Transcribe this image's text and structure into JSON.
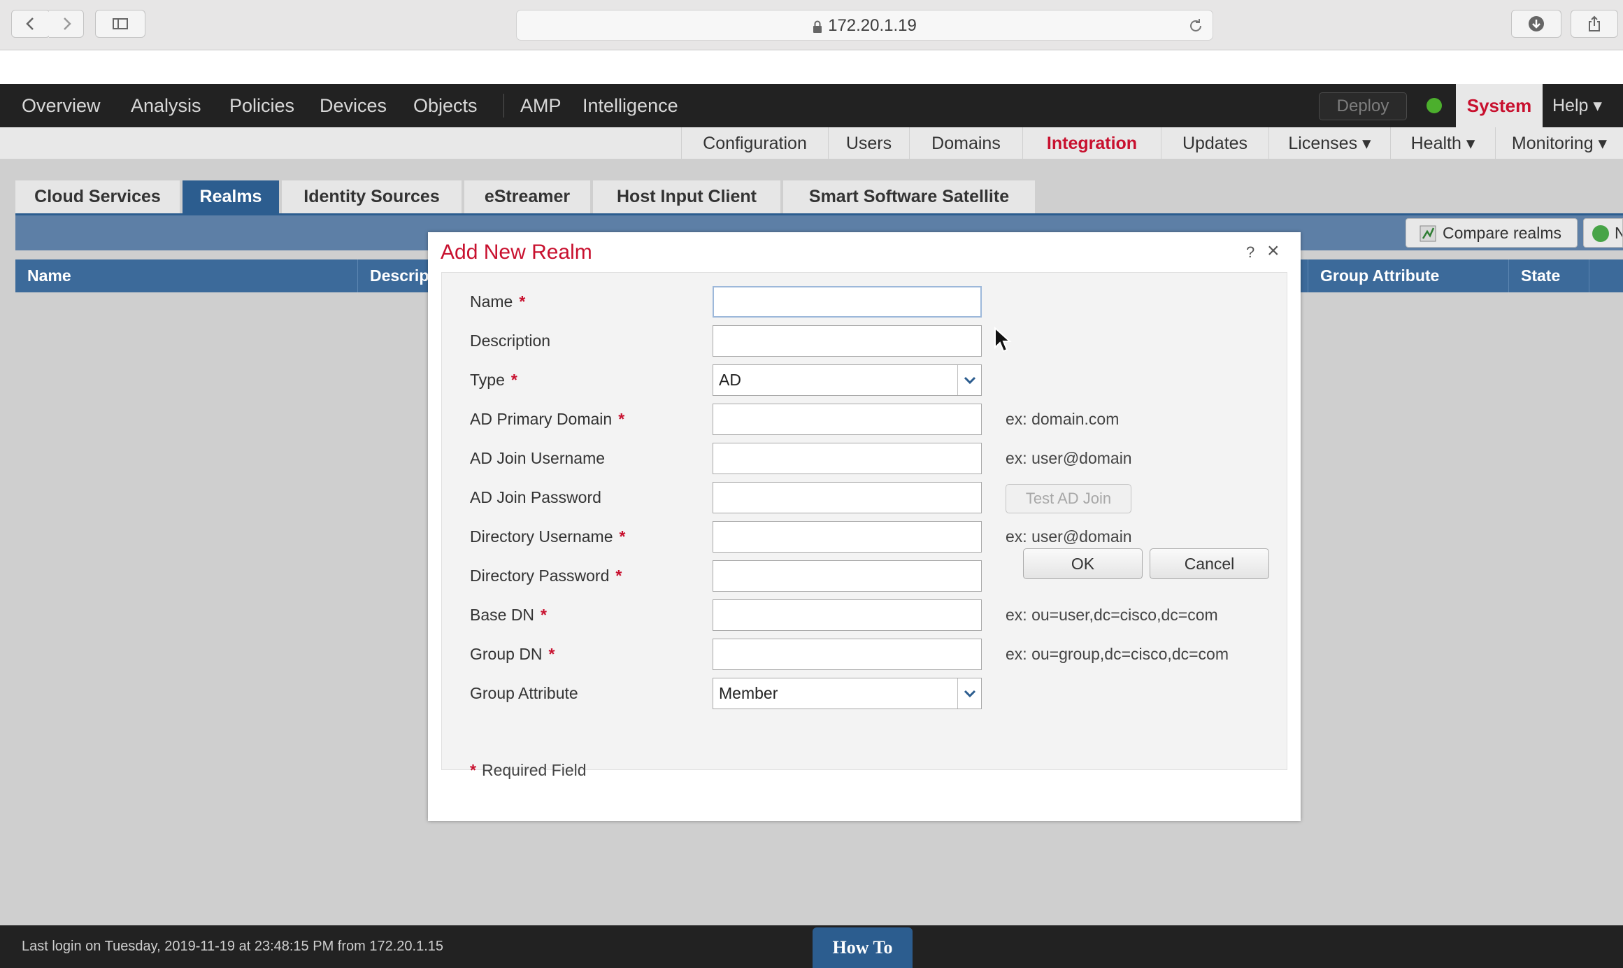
{
  "browser": {
    "url": "172.20.1.19"
  },
  "nav": {
    "items": [
      "Overview",
      "Analysis",
      "Policies",
      "Devices",
      "Objects",
      "AMP",
      "Intelligence"
    ],
    "deploy": "Deploy",
    "system": "System",
    "help": "Help ▾"
  },
  "subnav": {
    "items": [
      "Configuration",
      "Users",
      "Domains",
      "Integration",
      "Updates",
      "Licenses ▾",
      "Health ▾",
      "Monitoring ▾"
    ],
    "active": "Integration"
  },
  "tabs": {
    "items": [
      "Cloud Services",
      "Realms",
      "Identity Sources",
      "eStreamer",
      "Host Input Client",
      "Smart Software Satellite"
    ],
    "active": "Realms"
  },
  "toolbar": {
    "compare": "Compare realms",
    "add": "N"
  },
  "table": {
    "columns": [
      "Name",
      "Descrip",
      "Group Attribute",
      "State"
    ]
  },
  "modal": {
    "title": "Add New Realm",
    "help": "?",
    "close": "×",
    "fields": [
      {
        "label": "Name",
        "required": true,
        "value": "",
        "hint": ""
      },
      {
        "label": "Description",
        "required": false,
        "value": "",
        "hint": ""
      },
      {
        "label": "Type",
        "required": true,
        "value": "AD",
        "hint": ""
      },
      {
        "label": "AD Primary Domain",
        "required": true,
        "value": "",
        "hint": "ex: domain.com"
      },
      {
        "label": "AD Join Username",
        "required": false,
        "value": "",
        "hint": "ex: user@domain"
      },
      {
        "label": "AD Join Password",
        "required": false,
        "value": "",
        "hint": ""
      },
      {
        "label": "Directory Username",
        "required": true,
        "value": "",
        "hint": "ex: user@domain"
      },
      {
        "label": "Directory Password",
        "required": true,
        "value": "",
        "hint": ""
      },
      {
        "label": "Base DN",
        "required": true,
        "value": "",
        "hint": "ex: ou=user,dc=cisco,dc=com"
      },
      {
        "label": "Group DN",
        "required": true,
        "value": "",
        "hint": "ex: ou=group,dc=cisco,dc=com"
      },
      {
        "label": "Group Attribute",
        "required": false,
        "value": "Member",
        "hint": ""
      }
    ],
    "test_ad_join": "Test AD Join",
    "required_note": "Required Field",
    "ok": "OK",
    "cancel": "Cancel"
  },
  "footer": {
    "last_login": "Last login on Tuesday, 2019-11-19 at 23:48:15 PM from 172.20.1.15",
    "how_to": "How To"
  },
  "colors": {
    "accent_red": "#c8102e",
    "tab_blue": "#2c5d8f",
    "status_green": "#4caf2d"
  }
}
